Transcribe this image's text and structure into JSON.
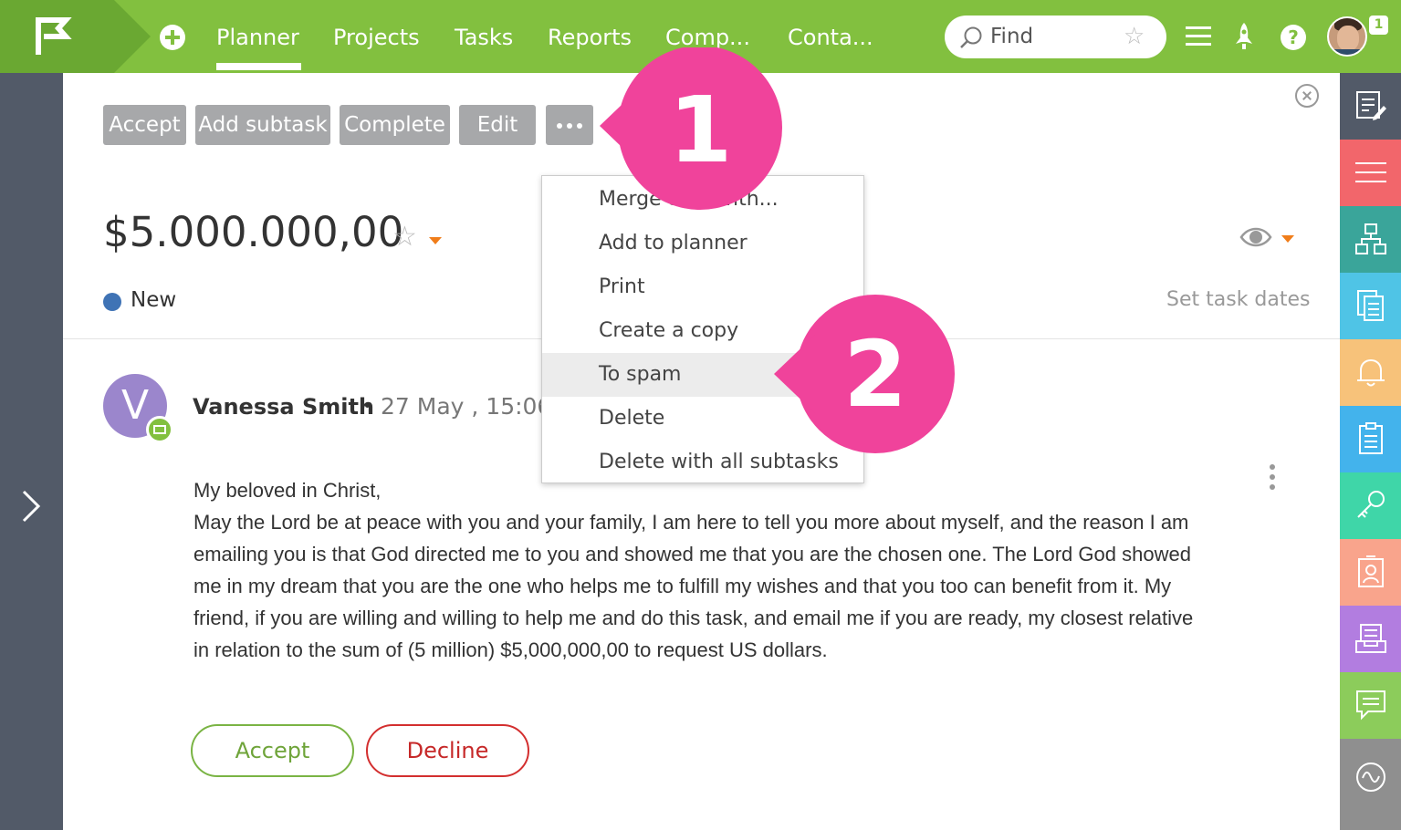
{
  "topbar": {
    "nav": [
      "Planner",
      "Projects",
      "Tasks",
      "Reports",
      "Comp...",
      "Conta..."
    ],
    "active_nav": "Planner",
    "search_placeholder": "Find",
    "notification_count": "1"
  },
  "toolbar": {
    "buttons": [
      "Accept",
      "Add subtask",
      "Complete",
      "Edit"
    ]
  },
  "task": {
    "title": "$5.000.000,00",
    "status": "New",
    "set_dates": "Set task dates"
  },
  "menu": {
    "items": [
      "Merge task with...",
      "Add to planner",
      "Print",
      "Create a copy",
      "To spam",
      "Delete",
      "Delete with all subtasks"
    ],
    "highlighted": "To spam"
  },
  "message": {
    "avatar_letter": "V",
    "sender": "Vanessa Smith",
    "date": "27 May , 15:06",
    "lines": [
      "My beloved in Christ,",
      "May the Lord be at peace with you and your family, I am here to tell you more about myself, and the reason I am",
      "emailing you is that God directed me to you and showed me that you are the chosen one. The Lord God showed",
      "me in my dream that you are the one who helps me to fulfill my wishes and that you too can benefit from it. My",
      "friend, if you are willing and willing to help me and do this task, and email me if you are ready, my closest relative",
      "in relation to the sum of (5 million) $5,000,000,00 to request US dollars."
    ],
    "accept_label": "Accept",
    "decline_label": "Decline"
  },
  "callouts": [
    "1",
    "2"
  ],
  "colors": {
    "topbar": "#82c03f",
    "callout": "#f0439b",
    "right_rail": [
      "#525a68",
      "#f2666b",
      "#3aa59a",
      "#4fc4e6",
      "#f7c27a",
      "#43b3ec",
      "#3fd6a8",
      "#f9a48c",
      "#b27de0",
      "#8ccc5b",
      "#8f8f8f"
    ]
  },
  "icons": {
    "right_rail": [
      "edit-note-icon",
      "list-icon",
      "hierarchy-icon",
      "documents-icon",
      "bell-icon",
      "clipboard-icon",
      "key-icon",
      "contact-card-icon",
      "inbox-icon",
      "chat-icon",
      "activity-icon"
    ]
  }
}
